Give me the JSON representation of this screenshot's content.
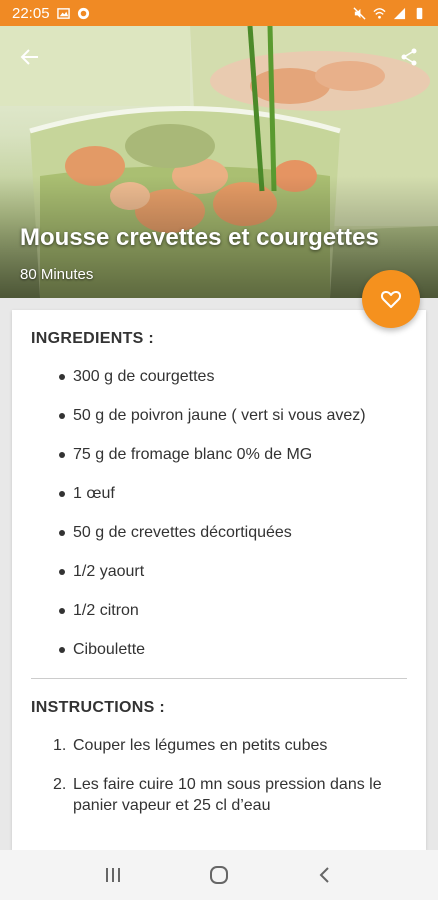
{
  "status_bar": {
    "time": "22:05",
    "background": "#f08a24"
  },
  "recipe": {
    "title": "Mousse crevettes et courgettes",
    "duration": "80 Minutes"
  },
  "ingredients": {
    "heading": "INGREDIENTS :",
    "items": [
      "300 g de courgettes",
      "50 g de poivron jaune ( vert si vous avez)",
      "75 g de fromage blanc 0% de MG",
      "1 œuf",
      "50 g de crevettes décortiquées",
      "1/2 yaourt",
      "1/2 citron",
      "Ciboulette"
    ]
  },
  "instructions": {
    "heading": "INSTRUCTIONS :",
    "steps": [
      {
        "num": "1.",
        "text": "Couper les légumes en petits cubes"
      },
      {
        "num": "2.",
        "text": "Les faire cuire 10 mn sous pression dans le panier vapeur et 25 cl d’eau"
      }
    ]
  },
  "icons": {
    "back": "arrow-back-icon",
    "share": "share-icon",
    "favorite": "heart-outline-icon",
    "nav_recents": "recents-icon",
    "nav_home": "home-icon",
    "nav_back": "chevron-left-icon"
  },
  "colors": {
    "accent": "#f5911e",
    "text": "#333333"
  }
}
